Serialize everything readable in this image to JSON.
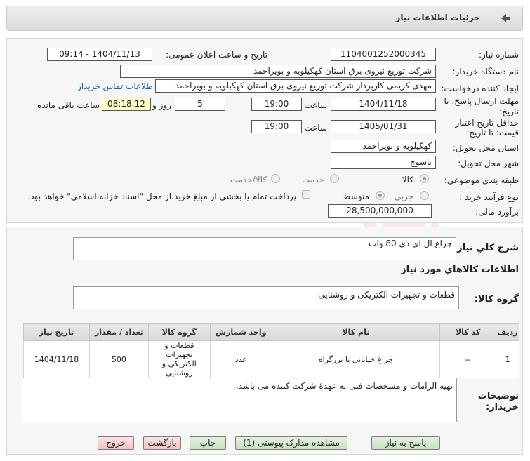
{
  "header": {
    "title": "جزئیات اطلاعات نیاز"
  },
  "form": {
    "need_number_label": "شماره نیاز:",
    "need_number": "1104001252000345",
    "announce_label": "تاریخ و ساعت اعلان عمومی:",
    "announce_value": "1404/11/13 - 09:14",
    "buyer_org_label": "نام دستگاه خریدار:",
    "buyer_org": "شرکت توزیع نیروی برق استان کهکیلویه و بویراحمد",
    "creator_label": "ایجاد کننده درخواست:",
    "creator": "مهدی کریمی کارپرداز شرکت توزیع نیروی برق استان کهکیلویه و بویراحمد",
    "contact_link": "اطلاعات تماس خریدار",
    "deadline_label_1": "مهلت ارسال پاسخ: تا",
    "deadline_label_2": "تاریخ:",
    "deadline_date": "1404/11/18",
    "time_label": "ساعت",
    "deadline_time": "19:00",
    "days_value": "5",
    "days_label": "روز و",
    "remaining_time": "08:18:12",
    "remaining_label": "ساعت باقی مانده",
    "validity_label_1": "حداقل تاریخ اعتبار",
    "validity_label_2": "قیمت: تا تاریخ:",
    "validity_date": "1405/01/31",
    "validity_time": "19:00",
    "province_label": "استان محل تحویل:",
    "province": "کهگیلویه و بویراحمد",
    "city_label": "شهر محل تحویل:",
    "city": "یاسوج",
    "category_label": "طبقه بندی موضوعی:",
    "category_options": [
      "کالا",
      "خدمت",
      "کالا/خدمت"
    ],
    "process_label": "نوع فرآیند خرید :",
    "process_options": [
      "جزیی",
      "متوسط"
    ],
    "payment_note": "پرداخت تمام یا بخشی از مبلغ خرید،از محل \"اسناد خزانه اسلامی\" خواهد بود.",
    "budget_label": "برآورد مالی:",
    "budget": "28,500,000,000"
  },
  "details": {
    "summary_label": "شرح كلي نياز:",
    "summary": "چراغ ال ای دی 80 وات",
    "goods_info_title": "اطلاعات كالاهاي مورد نياز",
    "goods_group_label": "گروه كالا:",
    "goods_group": "قطعات و تجهیزات الکتریکی و روشنایی",
    "table": {
      "headers": [
        "ردیف",
        "کد کالا",
        "نام کالا",
        "واحد شمارش",
        "گروه کالا",
        "تعداد / مقدار",
        "تاریخ نیاز"
      ],
      "rows": [
        [
          "1",
          "--",
          "چراغ خیابانی یا بزرگراه",
          "عدد",
          "قطعات و تجهیزات الکتریکی و روشنایی",
          "500",
          "1404/11/18"
        ]
      ]
    },
    "buyer_notes_label_1": "توضیحات",
    "buyer_notes_label_2": "خریدار:",
    "buyer_notes": "تهیه الزامات و مشخصات فنی به عهدۀ شرکت کننده می باشد."
  },
  "buttons": {
    "reply": "پاسخ به نیاز",
    "attachments": "مشاهده مدارک پیوستی (1)",
    "print": "چاپ",
    "back": "بازگشت",
    "exit": "خروج"
  }
}
